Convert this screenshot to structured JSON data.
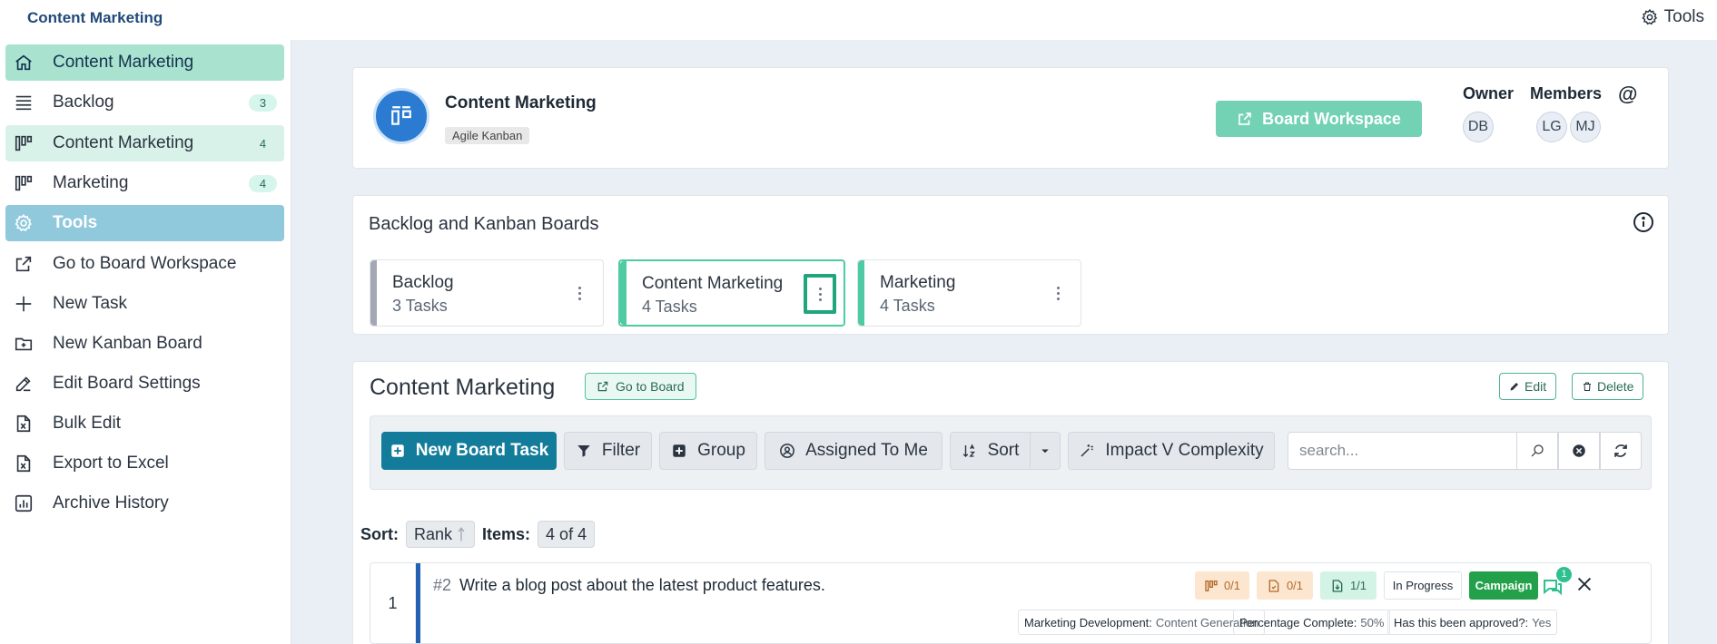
{
  "topbar": {
    "title": "Content Marketing",
    "tools_label": "Tools"
  },
  "sidebar": {
    "items": [
      {
        "label": "Content Marketing",
        "icon": "home-icon"
      },
      {
        "label": "Backlog",
        "count": "3",
        "icon": "list-icon"
      },
      {
        "label": "Content Marketing",
        "count": "4",
        "icon": "kanban-icon"
      },
      {
        "label": "Marketing",
        "count": "4",
        "icon": "kanban-icon"
      },
      {
        "label": "Tools",
        "icon": "gear-icon"
      },
      {
        "label": "Go to Board Workspace",
        "icon": "external-link-icon"
      },
      {
        "label": "New Task",
        "icon": "plus-icon"
      },
      {
        "label": "New Kanban Board",
        "icon": "folder-plus-icon"
      },
      {
        "label": "Edit Board Settings",
        "icon": "edit-icon"
      },
      {
        "label": "Bulk Edit",
        "icon": "file-excel-icon"
      },
      {
        "label": "Export to Excel",
        "icon": "file-excel-icon"
      },
      {
        "label": "Archive History",
        "icon": "chart-icon"
      }
    ]
  },
  "header": {
    "title": "Content Marketing",
    "badge": "Agile Kanban",
    "workspace_button": "Board Workspace",
    "owner_label": "Owner",
    "members_label": "Members",
    "owner": "DB",
    "members": [
      "LG",
      "MJ"
    ],
    "at": "@"
  },
  "boards": {
    "title": "Backlog and Kanban Boards",
    "items": [
      {
        "name": "Backlog",
        "tasks": "3 Tasks",
        "color": "#a3a8b4"
      },
      {
        "name": "Content Marketing",
        "tasks": "4 Tasks",
        "color": "#4ecba3"
      },
      {
        "name": "Marketing",
        "tasks": "4 Tasks",
        "color": "#4ecba3"
      }
    ]
  },
  "main": {
    "title": "Content Marketing",
    "go_to_board": "Go to Board",
    "edit": "Edit",
    "delete": "Delete",
    "toolbar": {
      "new_task": "New Board Task",
      "filter": "Filter",
      "group": "Group",
      "assigned": "Assigned To Me",
      "sort": "Sort",
      "impact": "Impact V Complexity",
      "search_placeholder": "search..."
    },
    "sort_label": "Sort:",
    "sort_value": "Rank",
    "items_label": "Items:",
    "items_value": "4 of 4",
    "task": {
      "rank": "1",
      "number": "#2",
      "name": "Write a blog post about the latest product features.",
      "chips": [
        "0/1",
        "0/1",
        "1/1"
      ],
      "status": "In Progress",
      "tag": "Campaign",
      "comments": "1",
      "fields": [
        {
          "label": "Marketing Development:",
          "value": "Content Generation"
        },
        {
          "label": "Percentage Complete:",
          "value": "50%"
        },
        {
          "label": "Has this been approved?:",
          "value": "Yes"
        }
      ]
    }
  },
  "colors": {
    "accent": "#4ecba3",
    "primary": "#147c9b",
    "tools_active": "#90c8dc",
    "home_active": "#a9e3cf"
  }
}
